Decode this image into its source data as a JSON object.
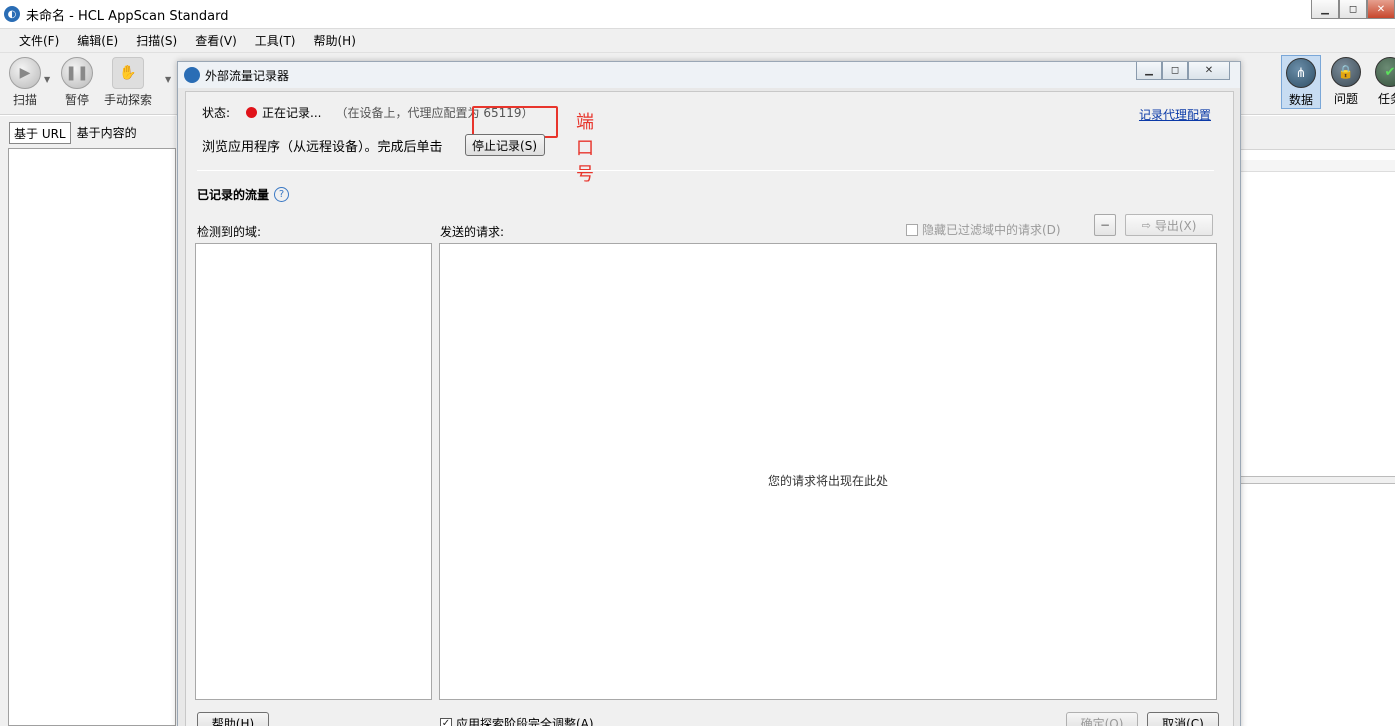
{
  "window": {
    "title": "未命名 - HCL AppScan Standard",
    "minimize": "▁",
    "restore": "◻",
    "close": "✕"
  },
  "menu": [
    "文件(F)",
    "编辑(E)",
    "扫描(S)",
    "查看(V)",
    "工具(T)",
    "帮助(H)"
  ],
  "toolbar": {
    "scan_label": "扫描",
    "pause_label": "暂停",
    "manual_explore_label": "手动探索",
    "data_label": "数据",
    "issues_label": "问题",
    "tasks_label": "任务"
  },
  "left_panel": {
    "tab_url": "基于 URL",
    "tab_content": "基于内容的"
  },
  "dialog": {
    "title": "外部流量记录器",
    "status_label": "状态:",
    "status_state": "正在记录...",
    "status_detail": "（在设备上，代理应配置为 65119）",
    "port": "65119",
    "port_annotation": "端口号",
    "proxy_config_link": "记录代理配置",
    "browse_instruction": "浏览应用程序（从远程设备）。完成后单击",
    "stop_button": "停止记录(S)",
    "recorded_traffic_title": "已记录的流量",
    "detected_domains_label": "检测到的域:",
    "sent_requests_label": "发送的请求:",
    "hide_filtered_label": "隐藏已过滤域中的请求(D)",
    "export_button": "导出(X)",
    "empty_requests_message": "您的请求将出现在此处",
    "help_button": "帮助(H)",
    "apply_label": "应用探索阶段完全调整(A)",
    "ok_button": "确定(O)",
    "cancel_button": "取消(C)"
  },
  "colors": {
    "recording_dot": "#e0131a",
    "annotation_red": "#e8352c",
    "link_blue": "#0b3aa8"
  }
}
